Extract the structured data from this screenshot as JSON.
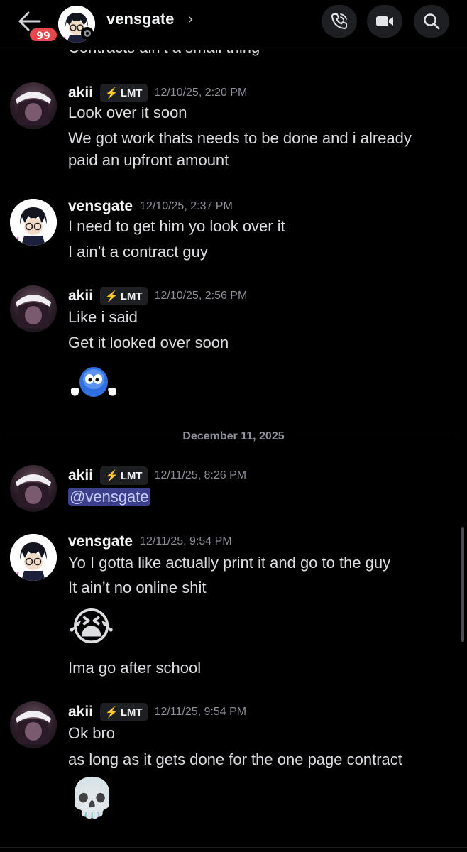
{
  "header": {
    "unread_badge": "99",
    "channel_name": "vensgate",
    "chevron": "›",
    "icons": [
      "back-arrow-icon",
      "phone-icon",
      "video-icon",
      "search-icon"
    ]
  },
  "cut_off_text": "Contracts ain’t a small thing",
  "messages": [
    {
      "author": "akii",
      "tag": "LMT",
      "time": "12/10/25, 2:20 PM",
      "lines": [
        "Look over it soon",
        "We got work thats needs to be done and i already",
        "paid an upfront amount"
      ]
    },
    {
      "author": "vensgate",
      "time": "12/10/25, 2:37 PM",
      "lines": [
        "I need to get him yo look over it",
        "I ain’t a contract guy"
      ]
    },
    {
      "author": "akii",
      "tag": "LMT",
      "time": "12/10/25, 2:56 PM",
      "lines": [
        "Like i said",
        "Get it looked over soon"
      ],
      "emoji": "shrug-blob-emoji"
    },
    {
      "author": "akii",
      "tag": "LMT",
      "time": "12/11/25, 8:26 PM",
      "mention": "@vensgate"
    },
    {
      "author": "vensgate",
      "time": "12/11/25, 9:54 PM",
      "lines": [
        "Yo I gotta like actually print it and go to the guy",
        "It ain’t no online shit"
      ],
      "emoji": "😭",
      "after_emoji": "Ima go after school"
    },
    {
      "author": "akii",
      "tag": "LMT",
      "time": "12/11/25, 9:54 PM",
      "lines": [
        "Ok bro",
        "as long as it gets done for the one page contract"
      ],
      "emoji": "💀"
    }
  ],
  "date_divider": "December 11, 2025",
  "colors": {
    "background": "#000000",
    "text": "#dcdde1",
    "muted": "#8e9099",
    "badge": "#e5484d",
    "mention_bg": "#3b3f8c"
  }
}
